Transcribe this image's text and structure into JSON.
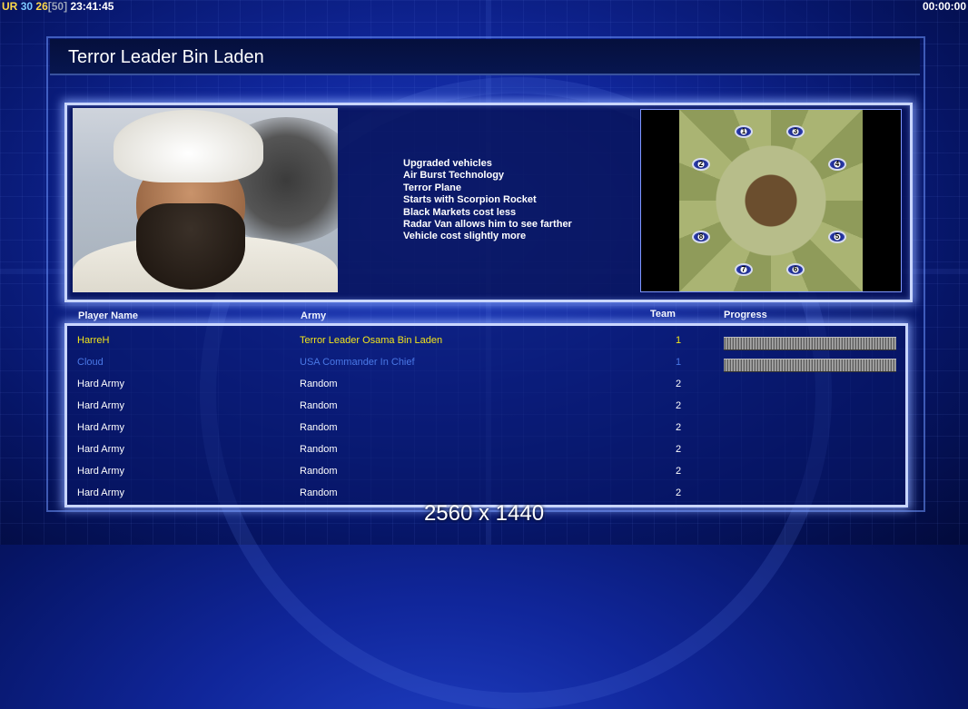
{
  "hud": {
    "prefix": "UR",
    "num_a": "30",
    "num_b": "26",
    "num_c": "[50]",
    "clock": "23:41:45",
    "timer": "00:00:00"
  },
  "title": "Terror Leader Bin Laden",
  "bonuses": [
    "Upgraded vehicles",
    "Air Burst Technology",
    "Terror Plane",
    "Starts with Scorpion Rocket",
    "Black Markets cost less",
    "Radar Van allows him to see farther",
    "Vehicle cost slightly more"
  ],
  "minimap": {
    "start_positions": [
      "1",
      "3",
      "2",
      "4",
      "8",
      "5",
      "7",
      "6"
    ]
  },
  "table": {
    "headers": {
      "name": "Player Name",
      "army": "Army",
      "team": "Team",
      "progress": "Progress"
    },
    "rows": [
      {
        "name": "HarreH",
        "army": "Terror Leader Osama Bin Laden",
        "team": "1",
        "color": "#f2e51a",
        "progress": 1.0
      },
      {
        "name": "Cloud",
        "army": "USA Commander In Chief",
        "team": "1",
        "color": "#4a78e6",
        "progress": 1.0
      },
      {
        "name": "Hard Army",
        "army": "Random",
        "team": "2",
        "color": "#ffffff"
      },
      {
        "name": "Hard Army",
        "army": "Random",
        "team": "2",
        "color": "#ffffff"
      },
      {
        "name": "Hard Army",
        "army": "Random",
        "team": "2",
        "color": "#ffffff"
      },
      {
        "name": "Hard Army",
        "army": "Random",
        "team": "2",
        "color": "#ffffff"
      },
      {
        "name": "Hard Army",
        "army": "Random",
        "team": "2",
        "color": "#ffffff"
      },
      {
        "name": "Hard Army",
        "army": "Random",
        "team": "2",
        "color": "#ffffff"
      }
    ]
  },
  "resolution_label": "2560 x 1440"
}
